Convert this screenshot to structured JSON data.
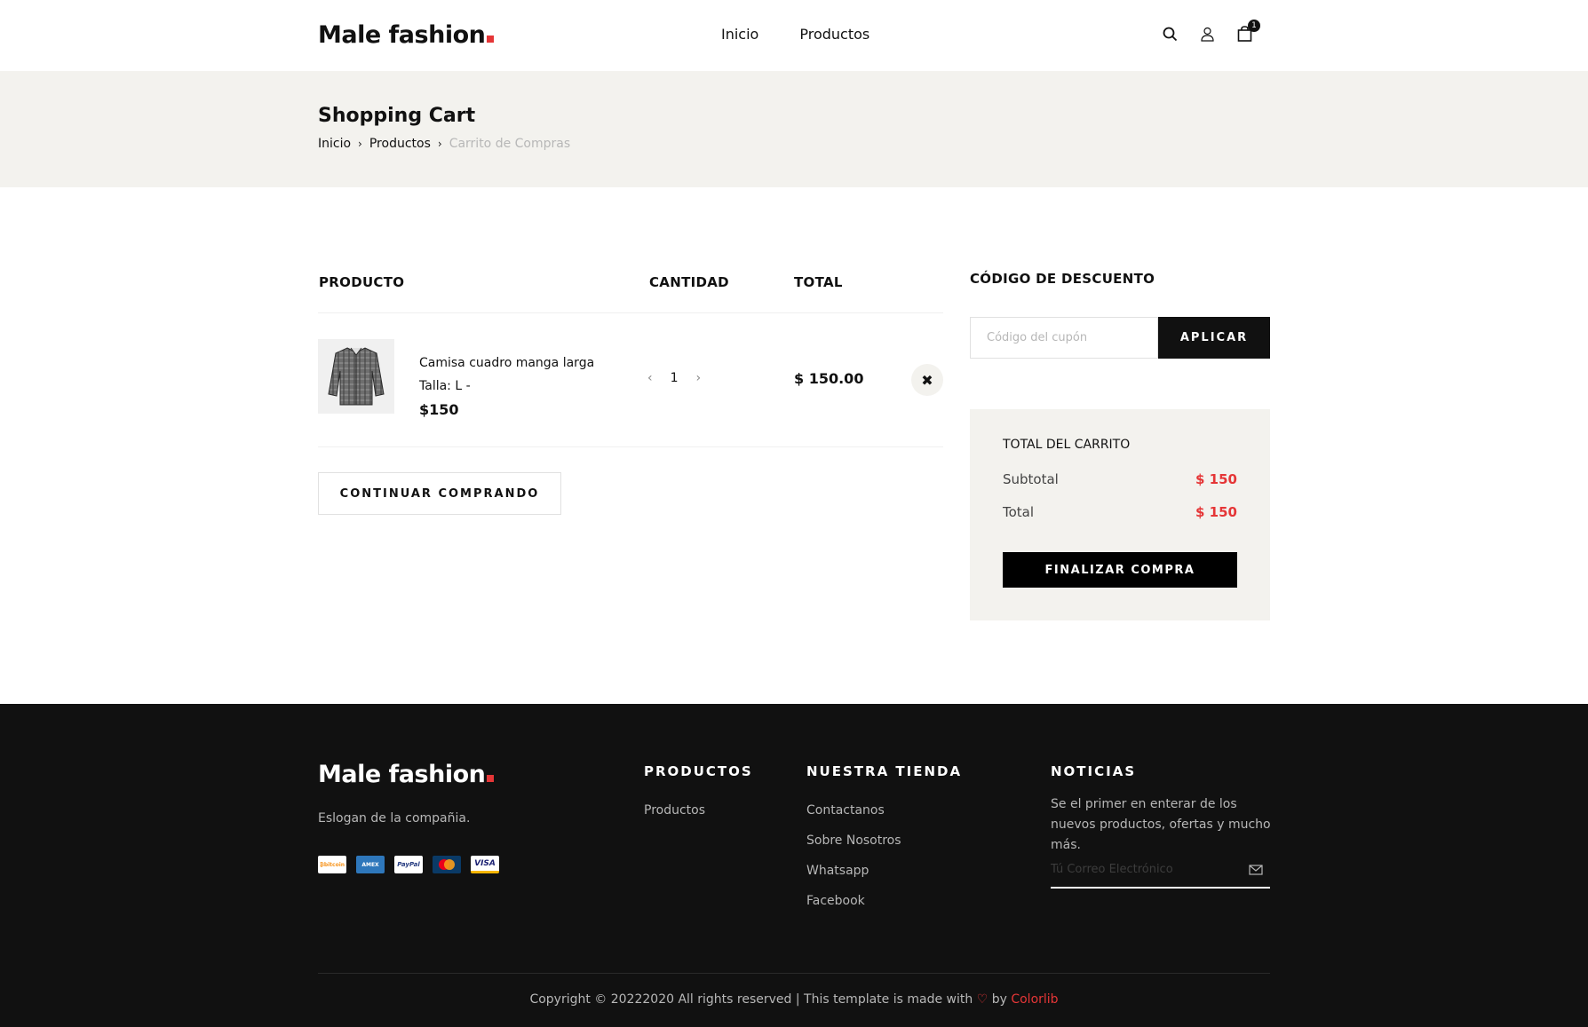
{
  "header": {
    "logo": "Male fashion",
    "nav": [
      "Inicio",
      "Productos"
    ],
    "cart_count": "1",
    "icons": [
      "search-icon",
      "user-icon",
      "shopping-bag-icon"
    ]
  },
  "breadcrumb_section": {
    "title": "Shopping Cart",
    "crumbs": [
      "Inicio",
      "Productos",
      "Carrito de Compras"
    ]
  },
  "cart": {
    "headers": {
      "product": "PRODUCTO",
      "quantity": "CANTIDAD",
      "total": "TOTAL"
    },
    "items": [
      {
        "name": "Camisa cuadro manga larga",
        "size": "Talla: L -",
        "price": "$150",
        "quantity": "1",
        "total": "$ 150.00"
      }
    ],
    "continue_label": "CONTINUAR COMPRANDO"
  },
  "discount": {
    "title": "CÓDIGO DE DESCUENTO",
    "placeholder": "Código del cupón",
    "apply_label": "APLICAR"
  },
  "cart_total": {
    "title": "TOTAL DEL CARRITO",
    "subtotal_label": "Subtotal",
    "subtotal_value": "$ 150",
    "total_label": "Total",
    "total_value": "$ 150",
    "checkout_label": "FINALIZAR COMPRA"
  },
  "footer": {
    "logo": "Male fashion",
    "tagline": "Eslogan de la compañia.",
    "payment_methods": [
      "bitcoin",
      "american express",
      "PayPal",
      "MasterCard",
      "VISA"
    ],
    "productos_heading": "PRODUCTOS",
    "productos_links": [
      "Productos"
    ],
    "tienda_heading": "NUESTRA TIENDA",
    "tienda_links": [
      "Contactanos",
      "Sobre Nosotros",
      "Whatsapp",
      "Facebook"
    ],
    "noticias_heading": "NOTICIAS",
    "noticias_text": "Se el primer en enterar de los nuevos productos, ofertas y mucho más.",
    "email_placeholder": "Tú Correo Electrónico",
    "copyright_text": "Copyright © 20222020 All rights reserved | This template is made with",
    "copyright_by": "by",
    "copyright_brand": "Colorlib"
  },
  "colors": {
    "accent": "#e53637",
    "dark": "#111111",
    "light_bg": "#f3f2ee"
  }
}
